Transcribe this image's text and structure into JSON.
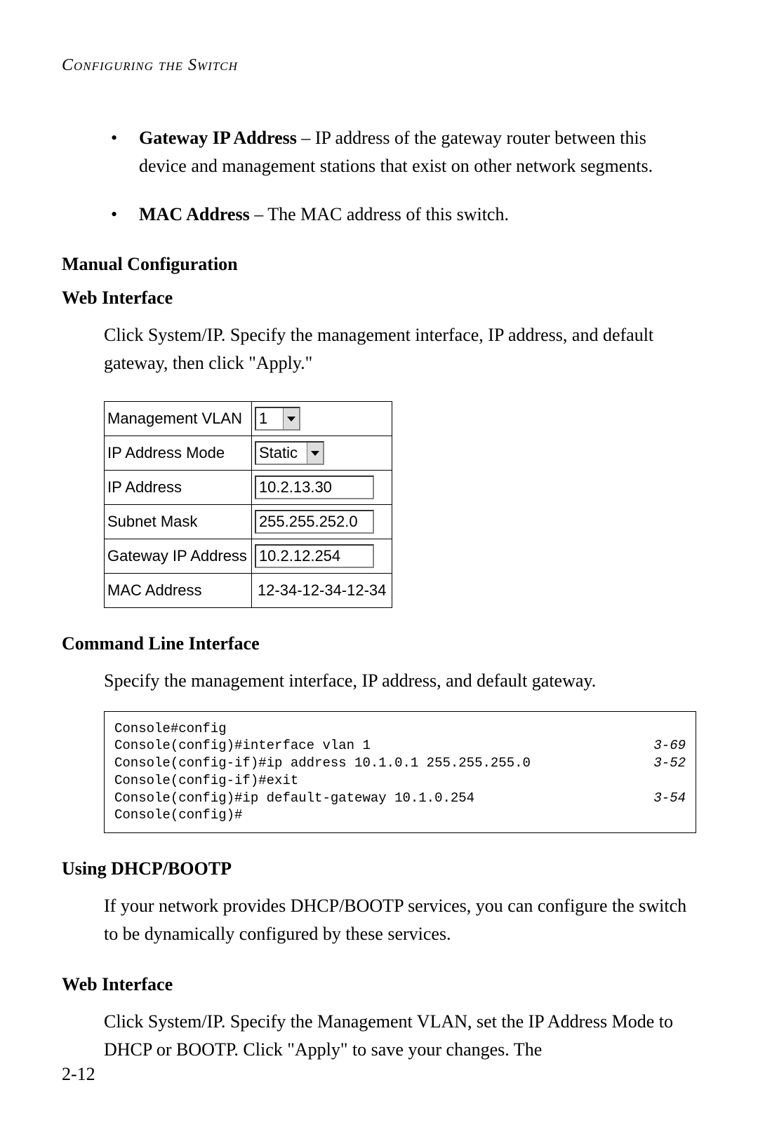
{
  "running_head": "Configuring the Switch",
  "bullets": [
    {
      "term": "Gateway IP Address",
      "desc": " – IP address of the gateway router between this device and management stations that exist on other network segments."
    },
    {
      "term": "MAC Address",
      "desc": " – The MAC address of this switch."
    }
  ],
  "sections": {
    "manual_config": "Manual Configuration",
    "web_if_1": "Web Interface",
    "web_p1": "Click System/IP. Specify the management interface, IP address, and default gateway, then click \"Apply.\"",
    "cli_if": "Command Line Interface",
    "cli_p": "Specify the management interface, IP address, and default gateway.",
    "dhcp": "Using DHCP/BOOTP",
    "dhcp_p": "If your network provides DHCP/BOOTP services, you can configure the switch to be dynamically configured by these services.",
    "web_if_2": "Web Interface",
    "web_p2": "Click System/IP. Specify the Management VLAN, set the IP Address Mode to DHCP or BOOTP. Click \"Apply\" to save your changes. The"
  },
  "config_table": {
    "rows": [
      {
        "label": "Management VLAN",
        "kind": "select",
        "value": "1"
      },
      {
        "label": "IP Address Mode",
        "kind": "select",
        "value": "Static"
      },
      {
        "label": "IP Address",
        "kind": "input",
        "value": "10.2.13.30"
      },
      {
        "label": "Subnet Mask",
        "kind": "input",
        "value": "255.255.252.0"
      },
      {
        "label": "Gateway IP Address",
        "kind": "input",
        "value": "10.2.12.254"
      },
      {
        "label": "MAC Address",
        "kind": "text",
        "value": "12-34-12-34-12-34"
      }
    ]
  },
  "cli": {
    "lines": [
      {
        "text": "Console#config",
        "ref": ""
      },
      {
        "text": "Console(config)#interface vlan 1",
        "ref": "3-69"
      },
      {
        "text": "Console(config-if)#ip address 10.1.0.1 255.255.255.0",
        "ref": "3-52"
      },
      {
        "text": "Console(config-if)#exit",
        "ref": ""
      },
      {
        "text": "Console(config)#ip default-gateway 10.1.0.254",
        "ref": "3-54"
      },
      {
        "text": "Console(config)#",
        "ref": ""
      }
    ]
  },
  "page_number": "2-12"
}
